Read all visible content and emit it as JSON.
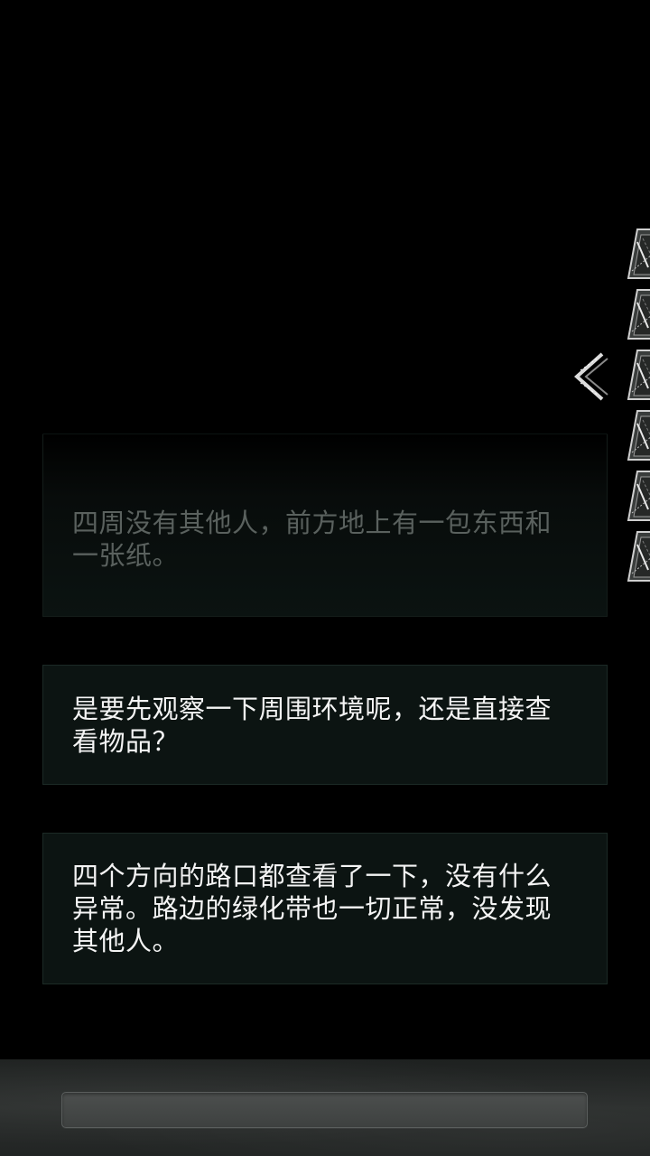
{
  "messages": [
    {
      "text": "四周没有其他人，前方地上有一包东西和一张纸。",
      "faded": true
    },
    {
      "text": "是要先观察一下周围环境呢，还是直接查看物品？",
      "faded": false
    },
    {
      "text": "四个方向的路口都查看了一下，没有什么异常。路边的绿化带也一切正常，没发现其他人。",
      "faded": false
    }
  ],
  "side_panel": {
    "toggle_icon": "chevron-left-icon",
    "card_count": 6,
    "card_icon": "evidence-card-icon"
  },
  "bottom_bar": {
    "input_value": ""
  },
  "colors": {
    "background": "#000000",
    "message_bg": "#0c1412",
    "message_border": "#1c2a26",
    "message_text": "#f4f4f4",
    "faded_text": "#5a615e"
  }
}
